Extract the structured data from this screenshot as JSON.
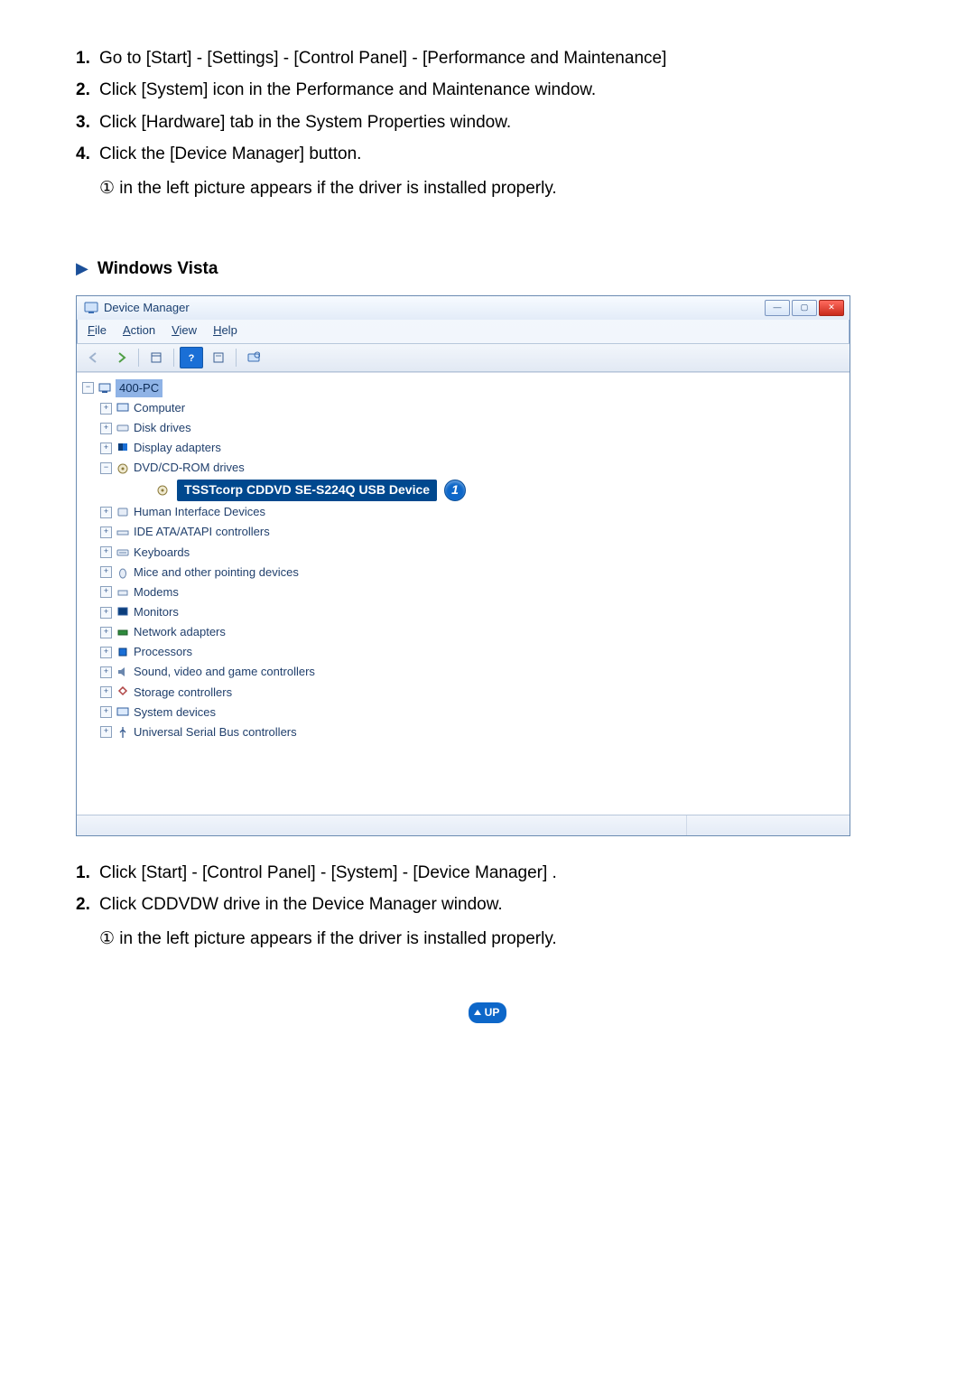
{
  "steps_xp": [
    "Go to [Start] - [Settings] - [Control Panel] - [Performance and Maintenance]",
    "Click [System] icon in the Performance and Maintenance window.",
    "Click [Hardware] tab in the System Properties window.",
    "Click the [Device Manager] button."
  ],
  "sub_xp": "① in the left picture appears if the driver is installed properly.",
  "section_title": "Windows Vista",
  "dm": {
    "title": "Device Manager",
    "menus": [
      "File",
      "Action",
      "View",
      "Help"
    ],
    "root": "400-PC",
    "nodes": [
      "Computer",
      "Disk drives",
      "Display adapters",
      "DVD/CD-ROM drives"
    ],
    "highlight": "TSSTcorp CDDVD SE-S224Q USB Device",
    "callout": "1",
    "nodes2": [
      "Human Interface Devices",
      "IDE ATA/ATAPI controllers",
      "Keyboards",
      "Mice and other pointing devices",
      "Modems",
      "Monitors",
      "Network adapters",
      "Processors",
      "Sound, video and game controllers",
      "Storage controllers",
      "System devices",
      "Universal Serial Bus controllers"
    ]
  },
  "steps_vista": [
    "Click [Start] - [Control Panel] - [System] - [Device Manager] .",
    "Click CDDVDW drive in the Device Manager window."
  ],
  "sub_vista": "① in the left picture appears if the driver is installed properly.",
  "up_label": "UP"
}
